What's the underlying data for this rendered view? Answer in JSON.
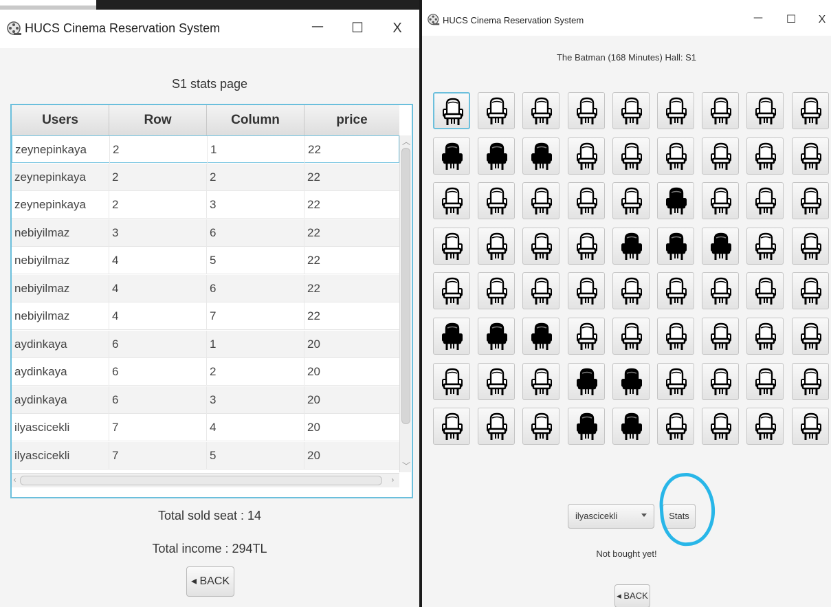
{
  "stats_window": {
    "title": "HUCS Cinema Reservation System",
    "app_icon": "film-reel-icon",
    "controls": {
      "minimize": "—",
      "maximize": "☐",
      "close": "X"
    },
    "heading": "S1 stats page",
    "table": {
      "columns": [
        "Users",
        "Row",
        "Column",
        "price"
      ],
      "rows": [
        [
          "zeynepinkaya",
          "2",
          "1",
          "22"
        ],
        [
          "zeynepinkaya",
          "2",
          "2",
          "22"
        ],
        [
          "zeynepinkaya",
          "2",
          "3",
          "22"
        ],
        [
          "nebiyilmaz",
          "3",
          "6",
          "22"
        ],
        [
          "nebiyilmaz",
          "4",
          "5",
          "22"
        ],
        [
          "nebiyilmaz",
          "4",
          "6",
          "22"
        ],
        [
          "nebiyilmaz",
          "4",
          "7",
          "22"
        ],
        [
          "aydinkaya",
          "6",
          "1",
          "20"
        ],
        [
          "aydinkaya",
          "6",
          "2",
          "20"
        ],
        [
          "aydinkaya",
          "6",
          "3",
          "20"
        ],
        [
          "ilyascicekli",
          "7",
          "4",
          "20"
        ],
        [
          "ilyascicekli",
          "7",
          "5",
          "20"
        ]
      ]
    },
    "total_sold": "Total sold seat : 14",
    "total_income": "Total income : 294TL",
    "back_button": "◂ BACK"
  },
  "seat_window": {
    "title": "HUCS Cinema Reservation System",
    "app_icon": "film-reel-icon",
    "controls": {
      "minimize": "—",
      "maximize": "☐",
      "close": "X"
    },
    "movie_info": "The Batman (168 Minutes) Hall: S1",
    "rows": 8,
    "cols": 9,
    "occupied_seats": [
      [
        2,
        1
      ],
      [
        2,
        2
      ],
      [
        2,
        3
      ],
      [
        3,
        6
      ],
      [
        4,
        5
      ],
      [
        4,
        6
      ],
      [
        4,
        7
      ],
      [
        6,
        1
      ],
      [
        6,
        2
      ],
      [
        6,
        3
      ],
      [
        7,
        4
      ],
      [
        7,
        5
      ],
      [
        8,
        4
      ],
      [
        8,
        5
      ]
    ],
    "seat_icon": "seat-icon",
    "colors": {
      "seat_free": "#ffffff",
      "seat_occupied": "#000000",
      "annotation": "#28b6e8",
      "focus": "#6bbfdc"
    },
    "user_select": "ilyascicekli",
    "stats_button": "Stats",
    "status_message": "Not bought yet!",
    "back_button": "◂ BACK"
  }
}
